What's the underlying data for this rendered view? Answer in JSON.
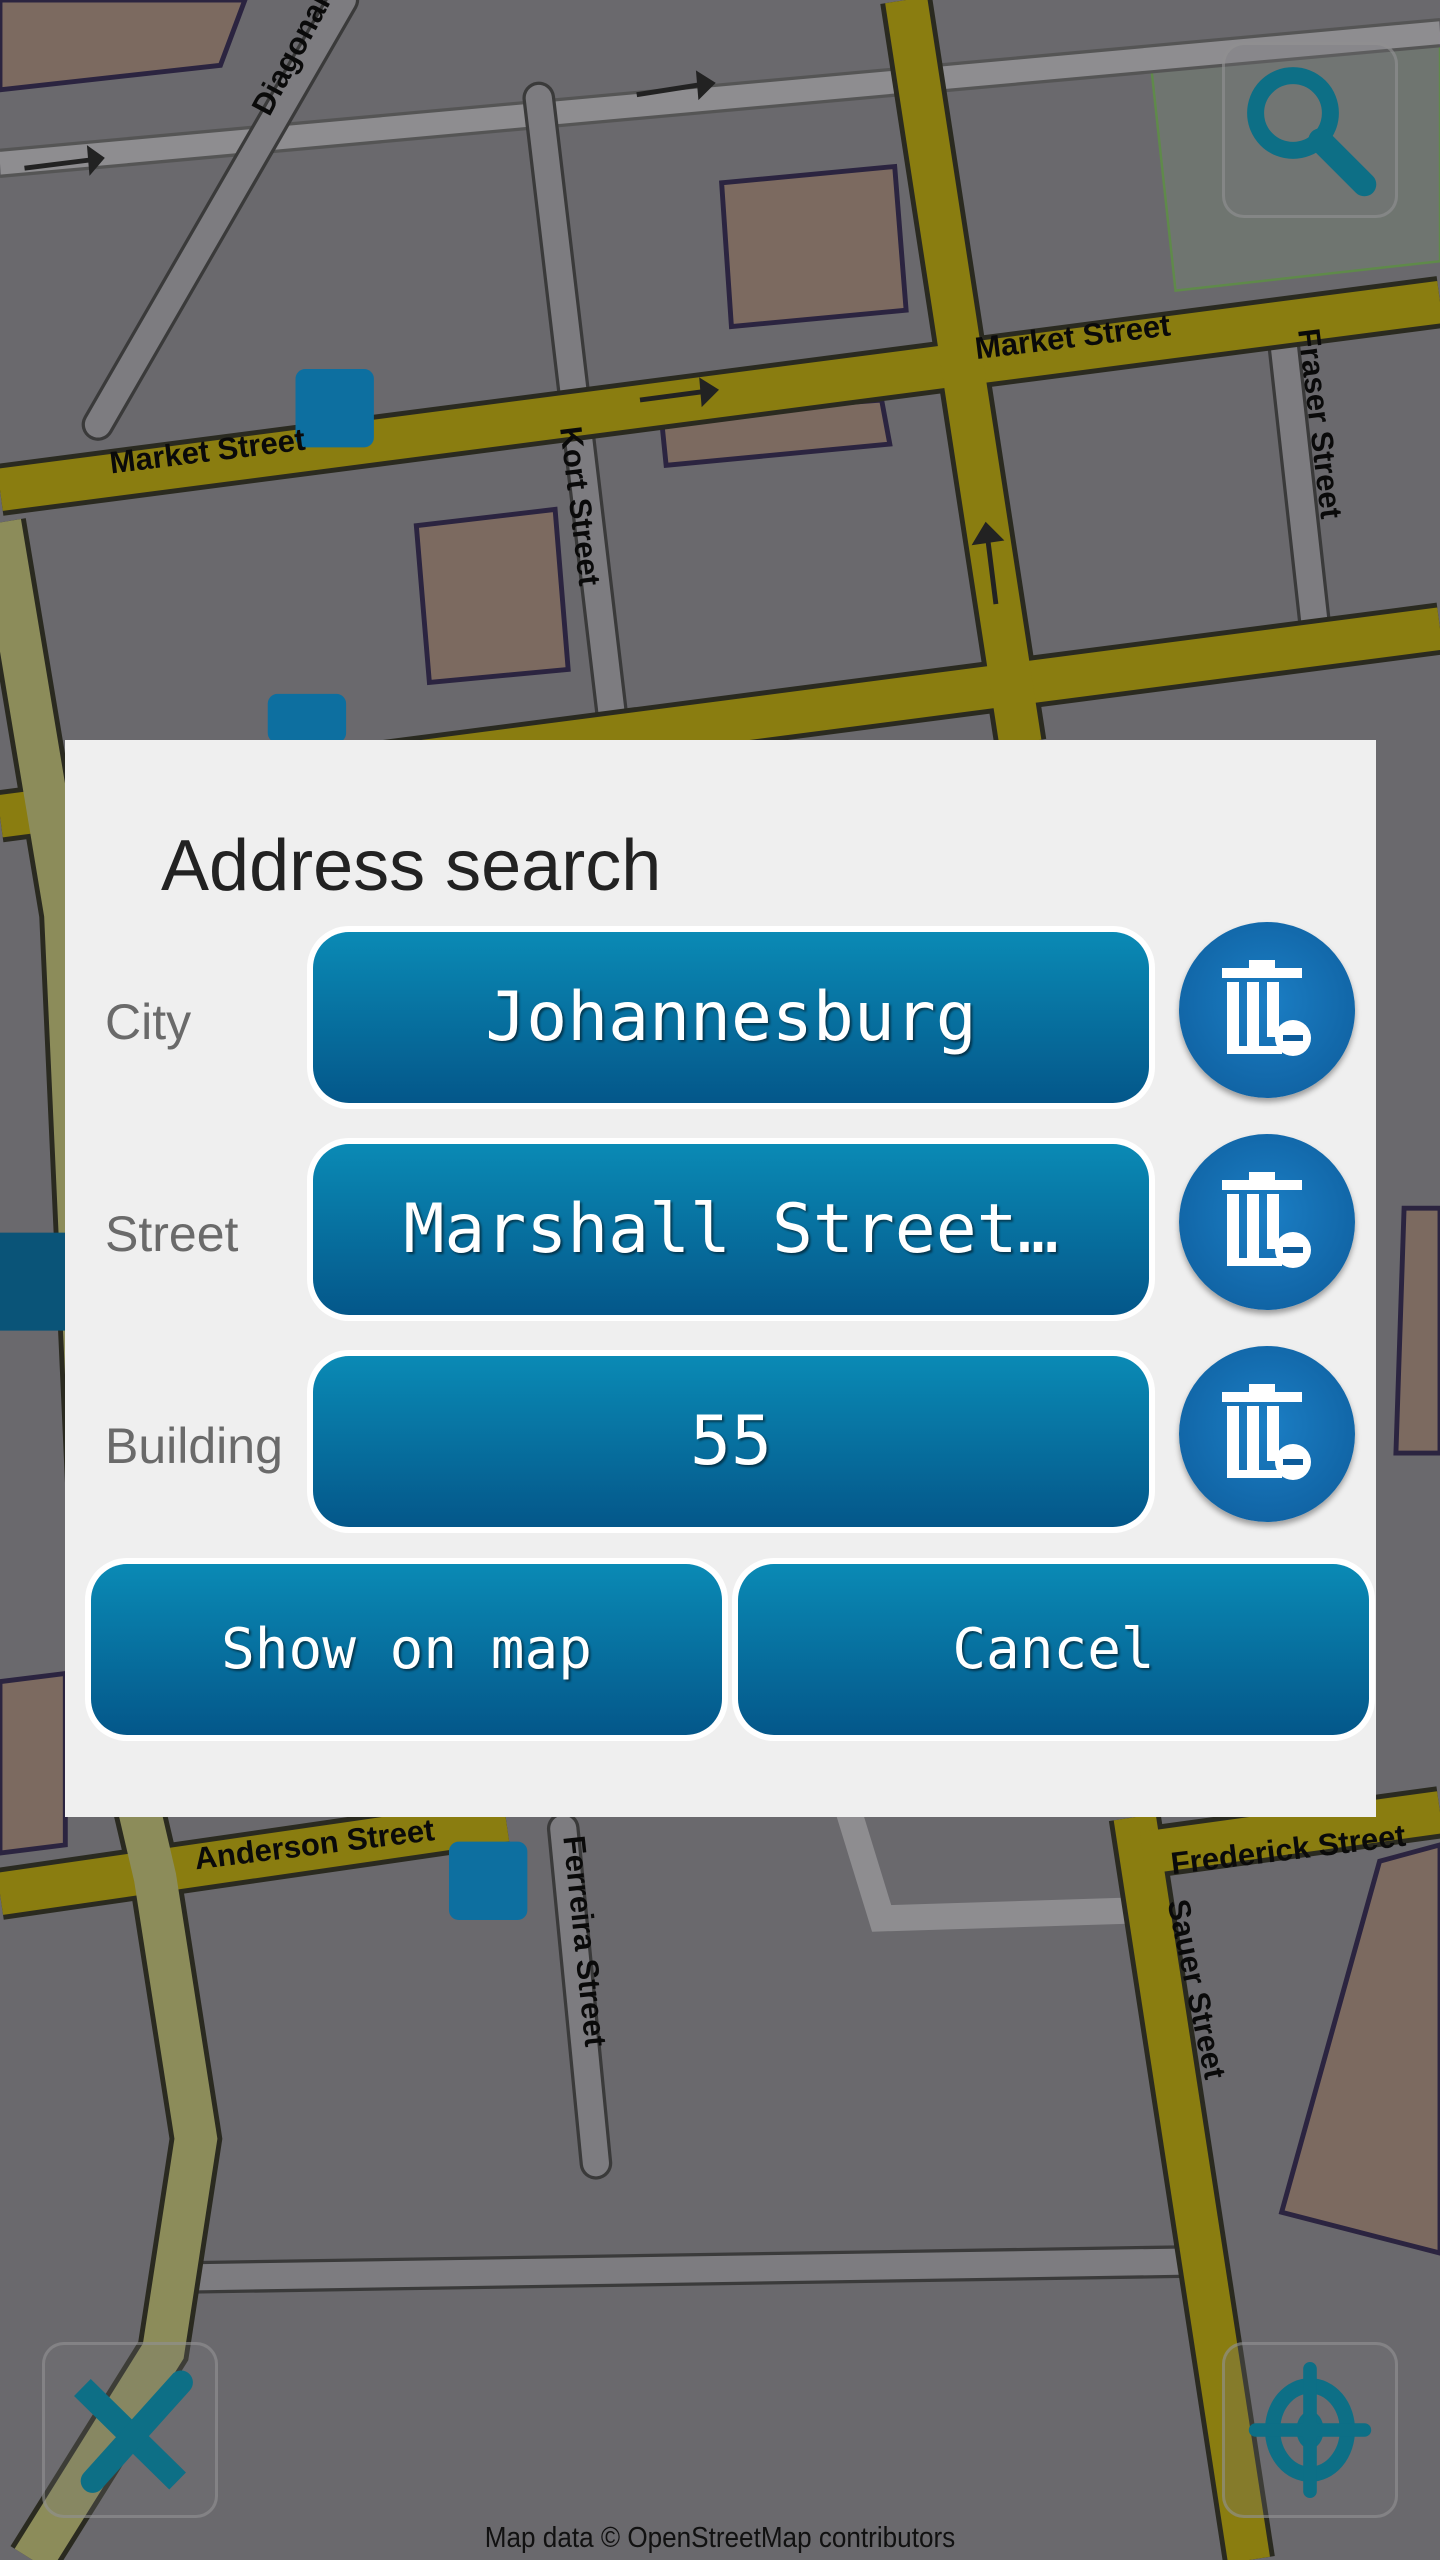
{
  "map": {
    "street_labels": {
      "diagonal": "Diagonal",
      "market_1": "Market Street",
      "market_2": "Market Street",
      "kort": "Kort Street",
      "fraser": "Fraser Street",
      "anderson": "Anderson Street",
      "ferreira": "Ferreira Street",
      "frederick": "Frederick Street",
      "sauer": "Sauer Street"
    },
    "attribution": "Map data © OpenStreetMap contributors",
    "controls": {
      "search_icon": "search-icon",
      "measure_icon": "ruler-pencil-icon",
      "locate_icon": "crosshair-icon"
    }
  },
  "dialog": {
    "title": "Address search",
    "fields": [
      {
        "label": "City",
        "value": "Johannesburg"
      },
      {
        "label": "Street",
        "value": "Marshall Street…"
      },
      {
        "label": "Building",
        "value": "55"
      }
    ],
    "clear_icon": "trash-minus-icon",
    "show_on_map_label": "Show on map",
    "cancel_label": "Cancel"
  },
  "colors": {
    "button_top": "#0a8ab5",
    "button_bottom": "#04578a",
    "dialog_bg": "#efefef",
    "road": "#8a7d10"
  }
}
